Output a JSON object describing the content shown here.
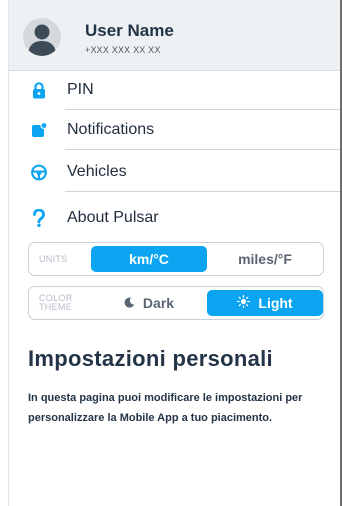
{
  "profile": {
    "name": "User Name",
    "phone": "+XXX XXX XX XX"
  },
  "menu": [
    {
      "label": "PIN",
      "icon": "lock-icon"
    },
    {
      "label": "Notifications",
      "icon": "notification-icon"
    },
    {
      "label": "Vehicles",
      "icon": "steering-wheel-icon"
    },
    {
      "label": "About Pulsar",
      "icon": "question-mark-icon"
    }
  ],
  "units": {
    "caption": "UNITS",
    "options": [
      "km/°C",
      "miles/°F"
    ],
    "selected": "km/°C"
  },
  "theme": {
    "caption_line1": "COLOR",
    "caption_line2": "THEME",
    "options": [
      "Dark",
      "Light"
    ],
    "selected": "Light"
  },
  "page": {
    "title": "Impostazioni personali",
    "description": "In questa pagina puoi modificare le impostazioni per personalizzare la Mobile App a tuo piacimento."
  },
  "colors": {
    "accent": "#0aa4f0",
    "text": "#243447",
    "header_bg": "#eef1f4"
  }
}
